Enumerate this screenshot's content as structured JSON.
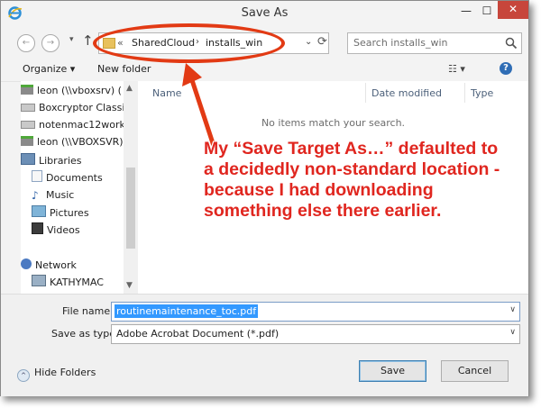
{
  "window": {
    "title": "Save As",
    "minimize_label": "—",
    "maximize_label": "☐",
    "close_label": "✕"
  },
  "nav": {
    "back_label": "←",
    "forward_label": "→",
    "recent_label": "▾",
    "up_label": "↑"
  },
  "address": {
    "overflow": "«",
    "crumbs": [
      "SharedCloud",
      "installs_win"
    ],
    "separator": "›",
    "dropdown": "⌄",
    "refresh": "⟳"
  },
  "search": {
    "placeholder": "Search installs_win",
    "icon": "search-icon"
  },
  "toolbar": {
    "organize_label": "Organize ▾",
    "new_folder_label": "New folder",
    "view_label": "☷ ▾",
    "help_label": "?"
  },
  "sidebar": {
    "items": [
      {
        "label": "leon (\\\\vboxsrv) (",
        "icon": "network-drive-icon"
      },
      {
        "label": "Boxcryptor Classi",
        "icon": "drive-icon"
      },
      {
        "label": "notenmac12work",
        "icon": "drive-icon"
      },
      {
        "label": "leon (\\\\VBOXSVR)",
        "icon": "network-drive-icon"
      },
      {
        "label": "Libraries",
        "icon": "libraries-icon"
      },
      {
        "label": "Documents",
        "icon": "documents-icon"
      },
      {
        "label": "Music",
        "icon": "music-icon"
      },
      {
        "label": "Pictures",
        "icon": "pictures-icon"
      },
      {
        "label": "Videos",
        "icon": "videos-icon"
      },
      {
        "label": "Network",
        "icon": "network-icon"
      },
      {
        "label": "KATHYMAC",
        "icon": "computer-icon"
      }
    ],
    "scroll_up": "▲",
    "scroll_down": "▼",
    "scroll_left": "◀",
    "scroll_right": "▶"
  },
  "files": {
    "columns": [
      "Name",
      "Date modified",
      "Type"
    ],
    "sort_indicator": "^",
    "empty_message": "No items match your search."
  },
  "form": {
    "filename_label": "File name:",
    "filename_value": "routinemaintenance_toc.pdf",
    "savetype_label": "Save as type:",
    "savetype_value": "Adobe Acrobat Document (*.pdf)",
    "dropdown": "∨"
  },
  "buttons": {
    "hide_folders_label": "Hide Folders",
    "hide_folders_icon": "^",
    "save_label": "Save",
    "cancel_label": "Cancel"
  },
  "annotation": {
    "text": "My “Save Target As…” defaulted to a decidedly non-standard location - because I had downloading something else there earlier.",
    "color": "#e0261f"
  }
}
